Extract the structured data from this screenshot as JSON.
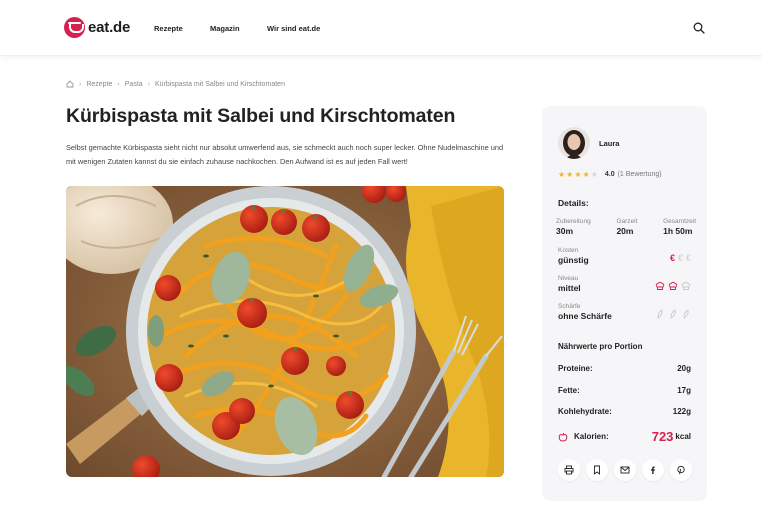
{
  "header": {
    "logo_text": "eat.de",
    "nav": [
      "Rezepte",
      "Magazin",
      "Wir sind eat.de"
    ],
    "search_icon": "search-icon"
  },
  "breadcrumb": {
    "home_icon": "home-icon",
    "items": [
      "Rezepte",
      "Pasta",
      "Kürbispasta mit Salbei und Kirschtomaten"
    ]
  },
  "recipe": {
    "title": "Kürbispasta mit Salbei und Kirschtomaten",
    "intro": "Selbst gemachte Kürbispasta sieht nicht nur absolut umwerfend aus, sie schmeckt auch noch super lecker. Ohne Nudelmaschine und mit wenigen Zutaten kannst du sie einfach zuhause nachkochen. Den Aufwand ist es auf jeden Fall wert!",
    "image": "pumpkin-pasta-photo"
  },
  "sidebar": {
    "author": "Laura",
    "rating": {
      "stars": 4,
      "max": 5,
      "value": "4.0",
      "count": "(1 Bewertung)"
    },
    "details_title": "Details:",
    "times": [
      {
        "label": "Zubereitung",
        "value": "30m"
      },
      {
        "label": "Garzeit",
        "value": "20m"
      },
      {
        "label": "Gesamtzeit",
        "value": "1h 50m"
      }
    ],
    "cost": {
      "label": "Kosten",
      "value": "günstig",
      "level": 1,
      "max": 3,
      "icon": "euro-icon"
    },
    "level": {
      "label": "Niveau",
      "value": "mittel",
      "level": 2,
      "max": 3,
      "icon": "chef-hat-icon"
    },
    "spice": {
      "label": "Schärfe",
      "value": "ohne Schärfe",
      "level": 0,
      "max": 3,
      "icon": "chili-icon"
    },
    "nutrition_title": "Nährwerte pro Portion",
    "nutrition": [
      {
        "label": "Proteine:",
        "value": "20",
        "unit": "g"
      },
      {
        "label": "Fette:",
        "value": "17",
        "unit": "g"
      },
      {
        "label": "Kohlehydrate:",
        "value": "122",
        "unit": "g"
      }
    ],
    "calories": {
      "label": "Kalorien:",
      "value": "723",
      "unit": "kcal"
    },
    "share": [
      "print-icon",
      "bookmark-icon",
      "mail-icon",
      "facebook-icon",
      "pinterest-icon"
    ]
  },
  "colors": {
    "accent": "#d6204e",
    "star": "#f0b429",
    "card_bg": "#f6f6f8"
  }
}
